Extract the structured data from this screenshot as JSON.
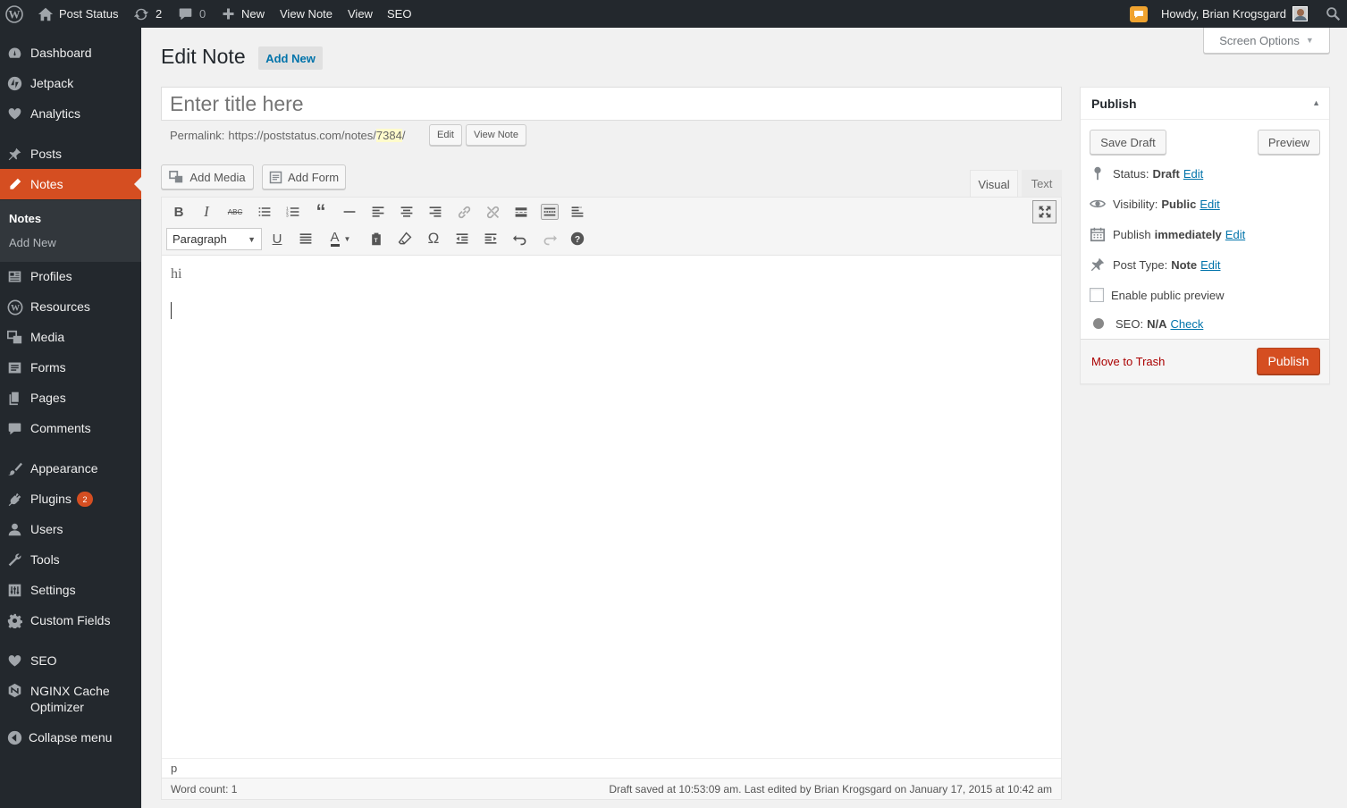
{
  "adminbar": {
    "site_name": "Post Status",
    "updates_count": "2",
    "comments_count": "0",
    "new_label": "New",
    "view_note_label": "View Note",
    "view_label": "View",
    "seo_label": "SEO",
    "greeting": "Howdy, Brian Krogsgard"
  },
  "sidebar": {
    "items": [
      {
        "label": "Dashboard",
        "icon": "dashboard-icon"
      },
      {
        "label": "Jetpack",
        "icon": "jetpack-icon"
      },
      {
        "label": "Analytics",
        "icon": "analytics-icon"
      },
      {
        "label": "Posts",
        "icon": "pin-icon"
      },
      {
        "label": "Notes",
        "icon": "pencil-icon"
      },
      {
        "label": "Profiles",
        "icon": "profile-icon"
      },
      {
        "label": "Resources",
        "icon": "wordpress-icon"
      },
      {
        "label": "Media",
        "icon": "media-icon"
      },
      {
        "label": "Forms",
        "icon": "forms-icon"
      },
      {
        "label": "Pages",
        "icon": "pages-icon"
      },
      {
        "label": "Comments",
        "icon": "comment-icon"
      },
      {
        "label": "Appearance",
        "icon": "brush-icon"
      },
      {
        "label": "Plugins",
        "icon": "plugin-icon"
      },
      {
        "label": "Users",
        "icon": "user-icon"
      },
      {
        "label": "Tools",
        "icon": "wrench-icon"
      },
      {
        "label": "Settings",
        "icon": "settings-icon"
      },
      {
        "label": "Custom Fields",
        "icon": "gear-icon"
      },
      {
        "label": "SEO",
        "icon": "seo-icon"
      },
      {
        "label": "NGINX Cache Optimizer",
        "icon": "nginx-icon"
      },
      {
        "label": "Collapse menu",
        "icon": "collapse-icon"
      }
    ],
    "submenu": [
      "Notes",
      "Add New"
    ],
    "plugins_badge": "2"
  },
  "screen_options_label": "Screen Options",
  "page": {
    "title": "Edit Note",
    "add_new_label": "Add New"
  },
  "title_field": {
    "placeholder": "Enter title here",
    "value": ""
  },
  "permalink": {
    "label": "Permalink:",
    "base": "https://poststatus.com/notes/",
    "slug": "7384",
    "suffix": "/",
    "edit_label": "Edit",
    "view_label": "View Note"
  },
  "media_buttons": {
    "add_media": "Add Media",
    "add_form": "Add Form"
  },
  "editor_tabs": {
    "visual": "Visual",
    "text": "Text"
  },
  "toolbar": {
    "format_select": "Paragraph"
  },
  "editor": {
    "content": "hi",
    "path": "p",
    "word_count": "Word count: 1",
    "status": "Draft saved at 10:53:09 am. Last edited by Brian Krogsgard on January 17, 2015 at 10:42 am"
  },
  "publish": {
    "title": "Publish",
    "save_draft": "Save Draft",
    "preview": "Preview",
    "status_label": "Status:",
    "status_value": "Draft",
    "visibility_label": "Visibility:",
    "visibility_value": "Public",
    "publish_label": "Publish",
    "publish_value": "immediately",
    "post_type_label": "Post Type:",
    "post_type_value": "Note",
    "edit_link": "Edit",
    "preview_checkbox": "Enable public preview",
    "seo_label": "SEO:",
    "seo_value": "N/A",
    "seo_link": "Check",
    "trash": "Move to Trash",
    "publish_button": "Publish"
  },
  "colors": {
    "admin_dark": "#23282d",
    "accent": "#d54e21",
    "link": "#0073aa"
  }
}
